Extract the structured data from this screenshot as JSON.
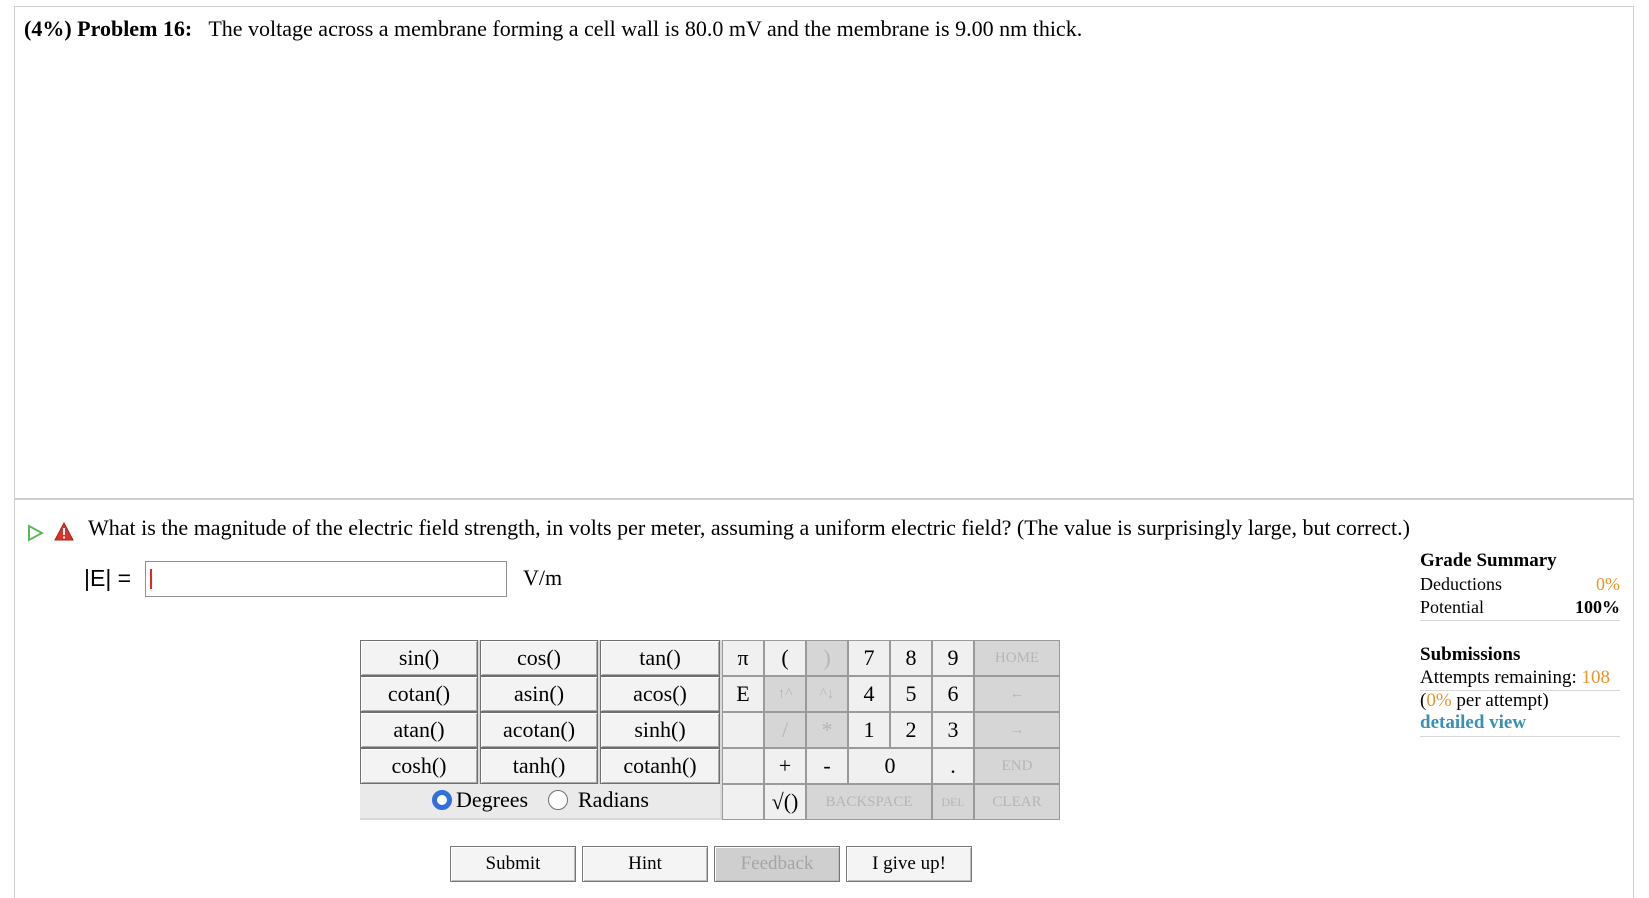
{
  "problem": {
    "weight": "(4%)",
    "label": "Problem 16:",
    "text": "The voltage across a membrane forming a cell wall is 80.0 mV and the membrane is 9.00 nm thick."
  },
  "question": {
    "text": "What is the magnitude of the electric field strength, in volts per meter, assuming a uniform electric field? (The value is surprisingly large, but correct.)",
    "answer_label": "|E| =",
    "answer_value": "",
    "unit": "V/m"
  },
  "keypad": {
    "functions": [
      [
        "sin()",
        "cos()",
        "tan()"
      ],
      [
        "cotan()",
        "asin()",
        "acos()"
      ],
      [
        "atan()",
        "acotan()",
        "sinh()"
      ],
      [
        "cosh()",
        "tanh()",
        "cotanh()"
      ]
    ],
    "symbols": {
      "pi": "π",
      "e": "E",
      "open_paren": "(",
      "close_paren": ")",
      "up": "↑^",
      "down": "^↓",
      "divide": "/",
      "multiply": "*",
      "plus": "+",
      "minus": "-",
      "sqrt": "√()",
      "dot": "."
    },
    "digits": {
      "d7": "7",
      "d8": "8",
      "d9": "9",
      "d4": "4",
      "d5": "5",
      "d6": "6",
      "d1": "1",
      "d2": "2",
      "d3": "3",
      "d0": "0"
    },
    "nav": {
      "home": "HOME",
      "left": "←",
      "right": "→",
      "end": "END",
      "backspace": "BACKSPACE",
      "del": "DEL",
      "clear": "CLEAR"
    },
    "mode": {
      "degrees": "Degrees",
      "radians": "Radians",
      "selected": "Degrees"
    }
  },
  "buttons": {
    "submit": "Submit",
    "hint": "Hint",
    "feedback": "Feedback",
    "give_up": "I give up!"
  },
  "grade_summary": {
    "title": "Grade Summary",
    "deductions_label": "Deductions",
    "deductions_value": "0%",
    "potential_label": "Potential",
    "potential_value": "100%"
  },
  "submissions": {
    "title": "Submissions",
    "attempts_label": "Attempts remaining:",
    "attempts_value": "108",
    "per_attempt_open": "(",
    "per_attempt_value": "0%",
    "per_attempt_label": "per attempt)",
    "detailed_view": "detailed view"
  },
  "colors": {
    "accent_orange": "#e8962a",
    "link_blue": "#3a8fb7",
    "radio_blue": "#2f6fe0",
    "play_green": "#5cb85c",
    "warn_red": "#d9362b"
  }
}
